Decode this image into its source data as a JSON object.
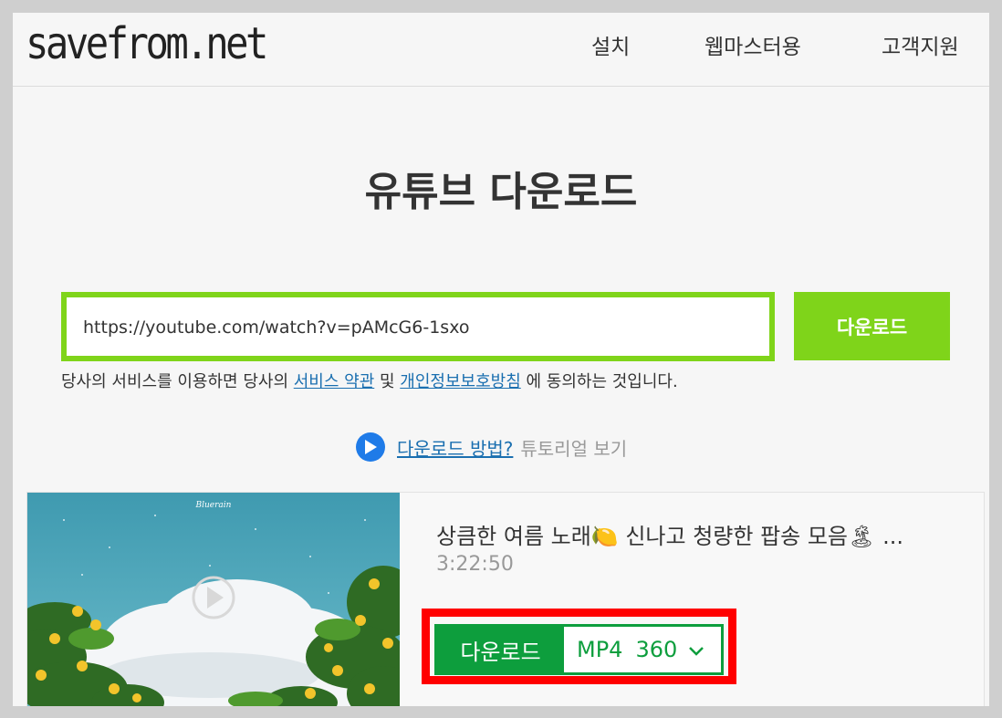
{
  "header": {
    "logo": "savefrom.net",
    "nav": [
      "설치",
      "웹마스터용",
      "고객지원"
    ]
  },
  "hero": {
    "title": "유튜브 다운로드"
  },
  "search": {
    "value": "https://youtube.com/watch?v=pAMcG6-1sxo",
    "button_label": "다운로드"
  },
  "terms": {
    "prefix": "당사의 서비스를 이용하면 당사의 ",
    "link1": "서비스 약관",
    "middle": " 및 ",
    "link2": "개인정보보호방침",
    "suffix": " 에 동의하는 것입니다."
  },
  "howto": {
    "link": "다운로드 방법?",
    "text": "튜토리얼 보기"
  },
  "video": {
    "thumbnail_caption": "Bluerain",
    "title": "상큼한 여름 노래🍋 신나고 청량한 팝송 모음🏝 ...",
    "duration": "3:22:50",
    "download_label": "다운로드",
    "format": "MP4",
    "quality": "360"
  },
  "colors": {
    "accent_green": "#7fd41a",
    "download_green": "#0d9e3d",
    "highlight_red": "#ff0000",
    "link_blue": "#1a6fb0"
  }
}
